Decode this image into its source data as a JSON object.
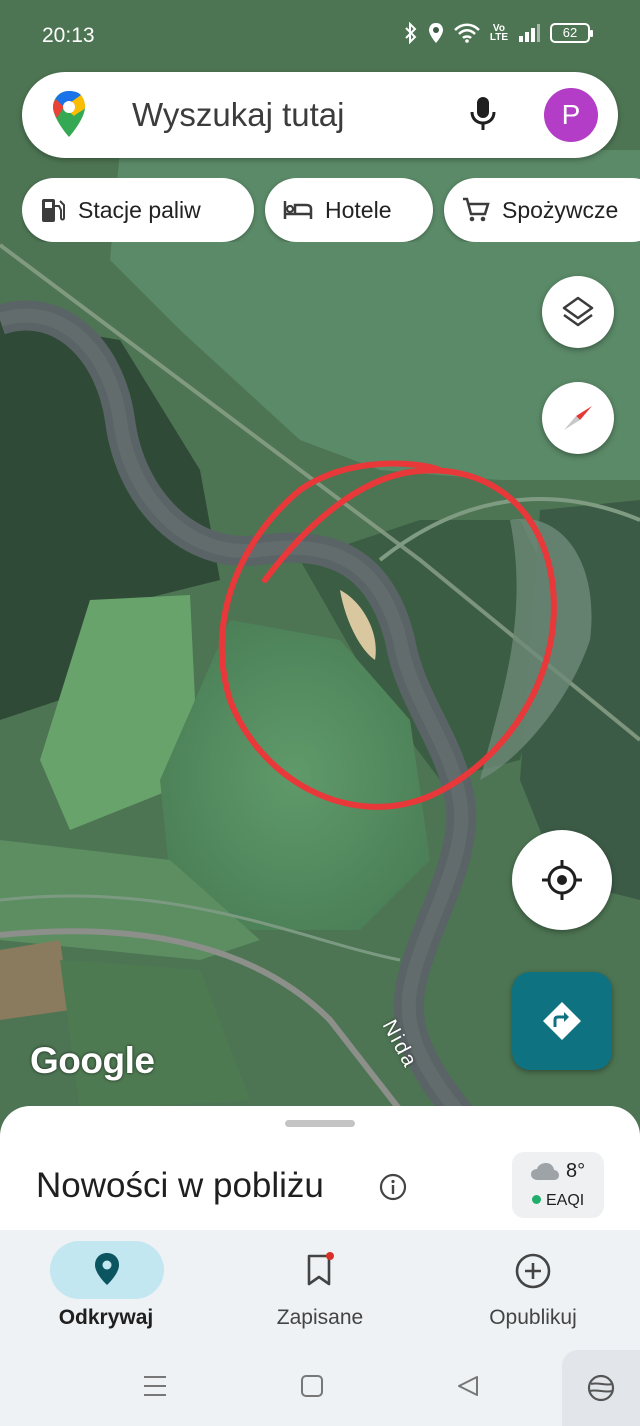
{
  "status_bar": {
    "time": "20:13",
    "volte_top": "Vo",
    "volte_bottom": "LTE",
    "battery": "62"
  },
  "search": {
    "placeholder": "Wyszukaj tutaj",
    "avatar_letter": "P"
  },
  "chips": [
    {
      "label": "Stacje paliw",
      "icon": "gas-station-icon"
    },
    {
      "label": "Hotele",
      "icon": "bed-icon"
    },
    {
      "label": "Spożywcze",
      "icon": "shopping-cart-icon"
    }
  ],
  "map": {
    "attribution": "Google",
    "river_label": "Nida"
  },
  "sheet": {
    "title": "Nowości w pobliżu",
    "weather_temp": "8°",
    "weather_aqi": "EAQI"
  },
  "nav": {
    "items": [
      {
        "label": "Odkrywaj",
        "icon": "explore-pin-icon",
        "active": true
      },
      {
        "label": "Zapisane",
        "icon": "bookmark-icon",
        "active": false
      },
      {
        "label": "Opublikuj",
        "icon": "add-circle-icon",
        "active": false
      }
    ]
  },
  "colors": {
    "accent": "#0e7281",
    "avatar": "#b33dc6",
    "annotation_circle": "#e8383a",
    "nav_active_pill": "#c2e7f0"
  }
}
